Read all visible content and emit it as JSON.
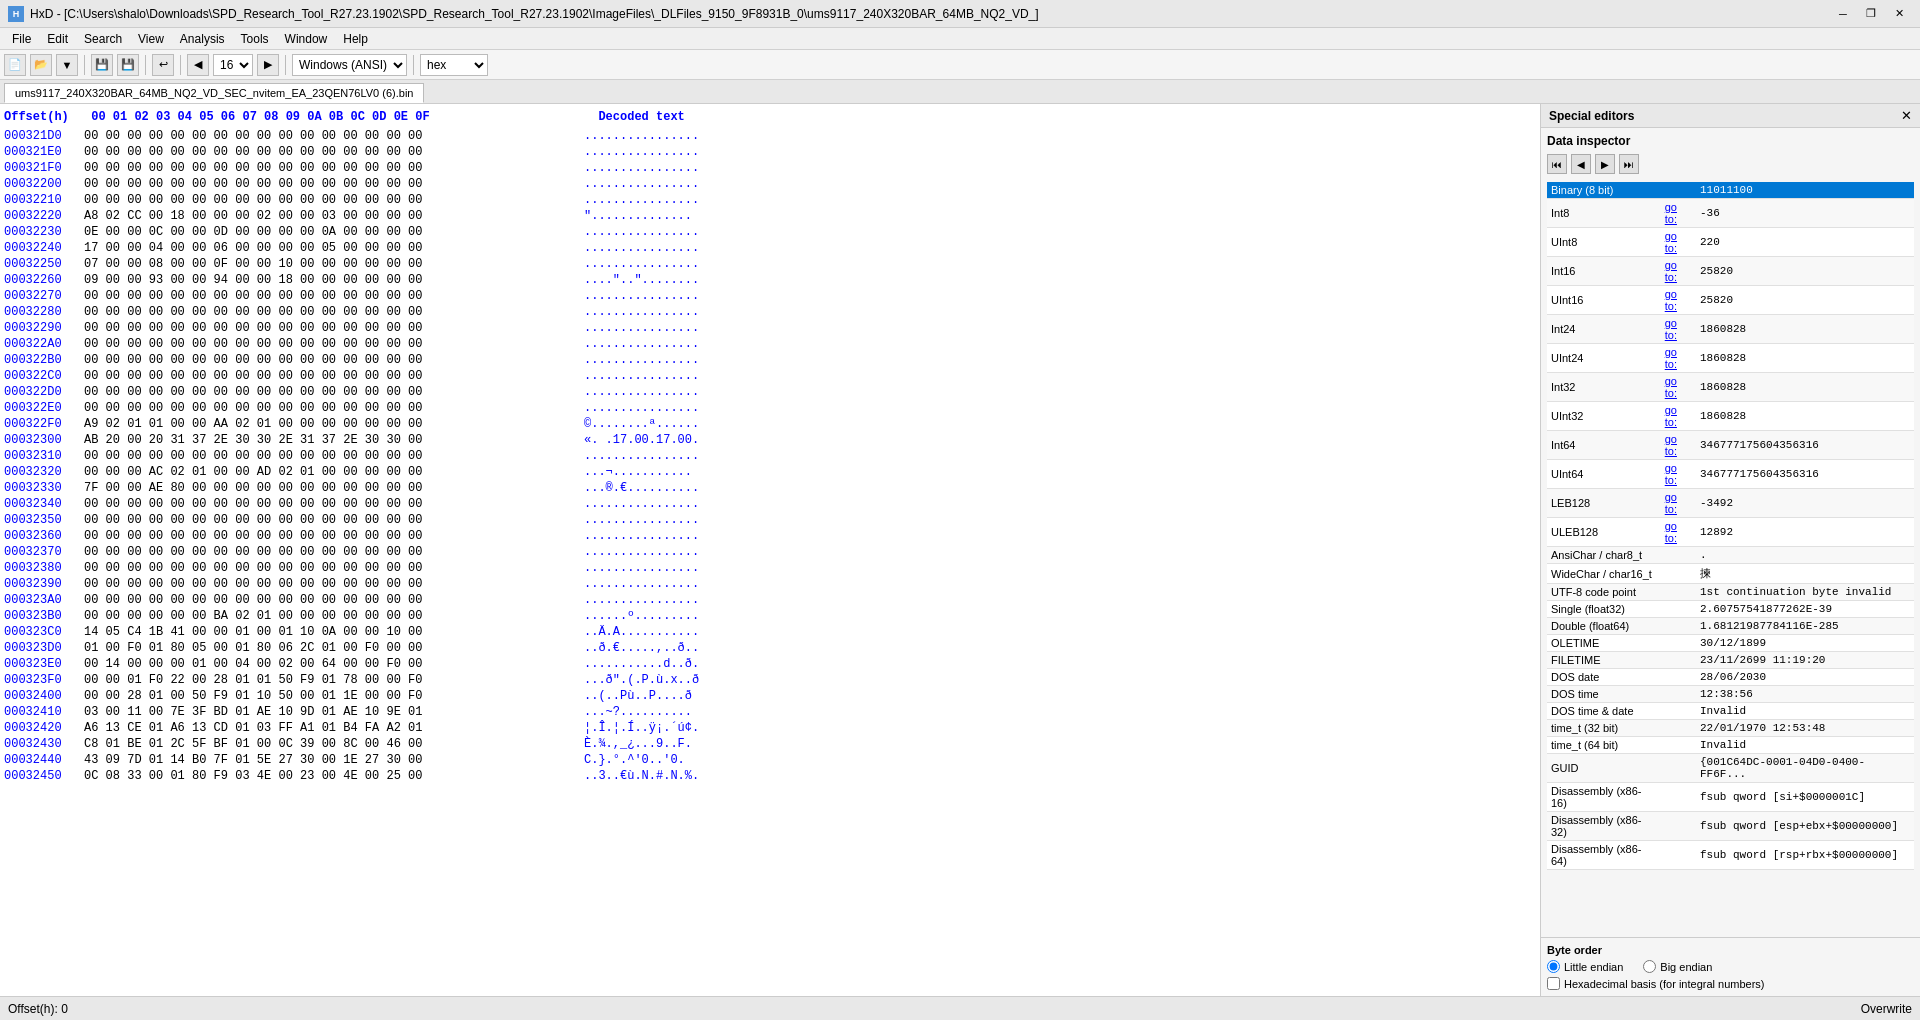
{
  "titleBar": {
    "title": "HxD - [C:\\Users\\shalo\\Downloads\\SPD_Research_Tool_R27.23.1902\\SPD_Research_Tool_R27.23.1902\\ImageFiles\\_DLFiles_9150_9F8931B_0\\ums9117_240X320BAR_64MB_NQ2_VD_]",
    "icon": "HxD",
    "minimize": "─",
    "maximize": "□",
    "close": "✕",
    "restore": "❐"
  },
  "menuBar": {
    "items": [
      "File",
      "Edit",
      "Search",
      "View",
      "Analysis",
      "Tools",
      "Window",
      "Help"
    ]
  },
  "toolbar": {
    "groupLabel": "16",
    "encoding": "Windows (ANSI)",
    "dataType": "hex"
  },
  "tab": {
    "label": "ums9117_240X320BAR_64MB_NQ2_VD_SEC_nvitem_EA_23QEN76LV0 (6).bin"
  },
  "hexEditor": {
    "columnHeader": "Offset(h)  00 01 02 03 04 05 06 07 08 09 0A 0B 0C 0D 0E 0F    Decoded text",
    "rows": [
      {
        "offset": "000321D0",
        "bytes": "00 00 00 00 00 00 00 00 00 00 00 00 00 00 00 00",
        "decoded": "................"
      },
      {
        "offset": "000321E0",
        "bytes": "00 00 00 00 00 00 00 00 00 00 00 00 00 00 00 00",
        "decoded": "................"
      },
      {
        "offset": "000321F0",
        "bytes": "00 00 00 00 00 00 00 00 00 00 00 00 00 00 00 00",
        "decoded": "................"
      },
      {
        "offset": "00032200",
        "bytes": "00 00 00 00 00 00 00 00 00 00 00 00 00 00 00 00",
        "decoded": "................"
      },
      {
        "offset": "00032210",
        "bytes": "00 00 00 00 00 00 00 00 00 00 00 00 00 00 00 00",
        "decoded": "................"
      },
      {
        "offset": "00032220",
        "bytes": "A8 02 CC 00 18 00 00 00 02 00 00 03 00 00 00 00",
        "decoded": "\".............."
      },
      {
        "offset": "00032230",
        "bytes": "0E 00 00 0C 00 00 0D 00 00 00 00 0A 00 00 00 00",
        "decoded": "................"
      },
      {
        "offset": "00032240",
        "bytes": "17 00 00 04 00 00 06 00 00 00 00 05 00 00 00 00",
        "decoded": "................"
      },
      {
        "offset": "00032250",
        "bytes": "07 00 00 08 00 00 0F 00 00 10 00 00 00 00 00 00",
        "decoded": "................"
      },
      {
        "offset": "00032260",
        "bytes": "09 00 00 93 00 00 94 00 00 18 00 00 00 00 00 00",
        "decoded": "....\"..\"........"
      },
      {
        "offset": "00032270",
        "bytes": "00 00 00 00 00 00 00 00 00 00 00 00 00 00 00 00",
        "decoded": "................"
      },
      {
        "offset": "00032280",
        "bytes": "00 00 00 00 00 00 00 00 00 00 00 00 00 00 00 00",
        "decoded": "................"
      },
      {
        "offset": "00032290",
        "bytes": "00 00 00 00 00 00 00 00 00 00 00 00 00 00 00 00",
        "decoded": "................"
      },
      {
        "offset": "000322A0",
        "bytes": "00 00 00 00 00 00 00 00 00 00 00 00 00 00 00 00",
        "decoded": "................"
      },
      {
        "offset": "000322B0",
        "bytes": "00 00 00 00 00 00 00 00 00 00 00 00 00 00 00 00",
        "decoded": "................"
      },
      {
        "offset": "000322C0",
        "bytes": "00 00 00 00 00 00 00 00 00 00 00 00 00 00 00 00",
        "decoded": "................"
      },
      {
        "offset": "000322D0",
        "bytes": "00 00 00 00 00 00 00 00 00 00 00 00 00 00 00 00",
        "decoded": "................"
      },
      {
        "offset": "000322E0",
        "bytes": "00 00 00 00 00 00 00 00 00 00 00 00 00 00 00 00",
        "decoded": "................"
      },
      {
        "offset": "000322F0",
        "bytes": "A9 02 01 01 00 00 AA 02 01 00 00 00 00 00 00 00",
        "decoded": "©........ª......"
      },
      {
        "offset": "00032300",
        "bytes": "AB 20 00 20 31 37 2E 30 30 2E 31 37 2E 30 30 00",
        "decoded": "«. .17.00.17.00."
      },
      {
        "offset": "00032310",
        "bytes": "00 00 00 00 00 00 00 00 00 00 00 00 00 00 00 00",
        "decoded": "................"
      },
      {
        "offset": "00032320",
        "bytes": "00 00 00 AC 02 01 00 00 AD 02 01 00 00 00 00 00",
        "decoded": "...¬.....­......"
      },
      {
        "offset": "00032330",
        "bytes": "7F 00 00 AE 80 00 00 00 00 00 00 00 00 00 00 00",
        "decoded": "...®.€.........."
      },
      {
        "offset": "00032340",
        "bytes": "00 00 00 00 00 00 00 00 00 00 00 00 00 00 00 00",
        "decoded": "................"
      },
      {
        "offset": "00032350",
        "bytes": "00 00 00 00 00 00 00 00 00 00 00 00 00 00 00 00",
        "decoded": "................"
      },
      {
        "offset": "00032360",
        "bytes": "00 00 00 00 00 00 00 00 00 00 00 00 00 00 00 00",
        "decoded": "................"
      },
      {
        "offset": "00032370",
        "bytes": "00 00 00 00 00 00 00 00 00 00 00 00 00 00 00 00",
        "decoded": "................"
      },
      {
        "offset": "00032380",
        "bytes": "00 00 00 00 00 00 00 00 00 00 00 00 00 00 00 00",
        "decoded": "................"
      },
      {
        "offset": "00032390",
        "bytes": "00 00 00 00 00 00 00 00 00 00 00 00 00 00 00 00",
        "decoded": "................"
      },
      {
        "offset": "000323A0",
        "bytes": "00 00 00 00 00 00 00 00 00 00 00 00 00 00 00 00",
        "decoded": "................"
      },
      {
        "offset": "000323B0",
        "bytes": "00 00 00 00 00 00 BA 02 01 00 00 00 00 00 00 00",
        "decoded": "......º........."
      },
      {
        "offset": "000323C0",
        "bytes": "14 05 C4 1B 41 00 00 01 00 01 10 0A 00 00 10 00",
        "decoded": "..Ä.A..........."
      },
      {
        "offset": "000323D0",
        "bytes": "01 00 F0 01 80 05 00 01 80 06 2C 01 00 F0 00 00",
        "decoded": "..ð.€.....,..ð.."
      },
      {
        "offset": "000323E0",
        "bytes": "00 14 00 00 00 01 00 04 00 02 00 64 00 00 F0 00",
        "decoded": "...........d..ð."
      },
      {
        "offset": "000323F0",
        "bytes": "00 00 01 F0 22 00 28 01 01 50 F9 01 78 00 00 F0",
        "decoded": "...ð\".(.P.ù.x..ð"
      },
      {
        "offset": "00032400",
        "bytes": "00 00 28 01 00 50 F9 01 10 50 00 01 1E 00 00 F0",
        "decoded": "..(..Pù..P....ð"
      },
      {
        "offset": "00032410",
        "bytes": "03 00 11 00 7E 3F BD 01 AE 10 9D 01 AE 10 9E 01",
        "decoded": "...~?.....­....."
      },
      {
        "offset": "00032420",
        "bytes": "A6 13 CE 01 A6 13 CD 01 03 FF A1 01 B4 FA A2 01",
        "decoded": "¦.Î.¦.Í..ÿ¡.´ú¢."
      },
      {
        "offset": "00032430",
        "bytes": "C8 01 BE 01 2C 5F BF 01 00 0C 39 00 8C 00 46 00",
        "decoded": "È.¾.,_¿...9..F."
      },
      {
        "offset": "00032440",
        "bytes": "43 09 7D 01 14 B0 7F 01 5E 27 30 00 1E 27 30 00",
        "decoded": "C.}.°.^'0..'0."
      },
      {
        "offset": "00032450",
        "bytes": "0C 08 33 00 01 80 F9 03 4E 00 23 00 4E 00 25 00",
        "decoded": "..3..€ù.N.#.N.%."
      }
    ]
  },
  "specialEditors": {
    "title": "Special editors",
    "closeBtn": "✕",
    "dataInspector": {
      "title": "Data inspector",
      "navButtons": [
        "⏮",
        "◀",
        "▶",
        "⏭"
      ],
      "fields": [
        {
          "name": "Binary (8 bit)",
          "gotoLink": null,
          "value": "11011100",
          "selected": true
        },
        {
          "name": "Int8",
          "gotoLink": "go to:",
          "value": "-36"
        },
        {
          "name": "UInt8",
          "gotoLink": "go to:",
          "value": "220"
        },
        {
          "name": "Int16",
          "gotoLink": "go to:",
          "value": "25820"
        },
        {
          "name": "UInt16",
          "gotoLink": "go to:",
          "value": "25820"
        },
        {
          "name": "Int24",
          "gotoLink": "go to:",
          "value": "1860828"
        },
        {
          "name": "UInt24",
          "gotoLink": "go to:",
          "value": "1860828"
        },
        {
          "name": "Int32",
          "gotoLink": "go to:",
          "value": "1860828"
        },
        {
          "name": "UInt32",
          "gotoLink": "go to:",
          "value": "1860828"
        },
        {
          "name": "Int64",
          "gotoLink": "go to:",
          "value": "346777175604356316"
        },
        {
          "name": "UInt64",
          "gotoLink": "go to:",
          "value": "346777175604356316"
        },
        {
          "name": "LEB128",
          "gotoLink": "go to:",
          "value": "-3492"
        },
        {
          "name": "ULEB128",
          "gotoLink": "go to:",
          "value": "12892"
        },
        {
          "name": "AnsiChar / char8_t",
          "gotoLink": null,
          "value": "."
        },
        {
          "name": "WideChar / char16_t",
          "gotoLink": null,
          "value": "揀"
        },
        {
          "name": "UTF-8 code point",
          "gotoLink": null,
          "value": "1st continuation byte invalid"
        },
        {
          "name": "Single (float32)",
          "gotoLink": null,
          "value": "2.60757541877262E-39"
        },
        {
          "name": "Double (float64)",
          "gotoLink": null,
          "value": "1.68121987784116E-285"
        },
        {
          "name": "OLETIME",
          "gotoLink": null,
          "value": "30/12/1899"
        },
        {
          "name": "FILETIME",
          "gotoLink": null,
          "value": "23/11/2699 11:19:20"
        },
        {
          "name": "DOS date",
          "gotoLink": null,
          "value": "28/06/2030"
        },
        {
          "name": "DOS time",
          "gotoLink": null,
          "value": "12:38:56"
        },
        {
          "name": "DOS time & date",
          "gotoLink": null,
          "value": "Invalid"
        },
        {
          "name": "time_t (32 bit)",
          "gotoLink": null,
          "value": "22/01/1970 12:53:48"
        },
        {
          "name": "time_t (64 bit)",
          "gotoLink": null,
          "value": "Invalid"
        },
        {
          "name": "GUID",
          "gotoLink": null,
          "value": "{001C64DC-0001-04D0-0400-FF6F..."
        },
        {
          "name": "Disassembly (x86-16)",
          "gotoLink": null,
          "value": "fsub qword [si+$0000001C]"
        },
        {
          "name": "Disassembly (x86-32)",
          "gotoLink": null,
          "value": "fsub qword [esp+ebx+$00000000]"
        },
        {
          "name": "Disassembly (x86-64)",
          "gotoLink": null,
          "value": "fsub qword [rsp+rbx+$00000000]"
        }
      ]
    },
    "byteOrder": {
      "title": "Byte order",
      "littleEndian": "Little endian",
      "bigEndian": "Big endian",
      "littleEndianSelected": true,
      "hexBasisLabel": "Hexadecimal basis (for integral numbers)"
    }
  },
  "statusBar": {
    "offset": "Offset(h): 0",
    "mode": "Overwrite"
  }
}
